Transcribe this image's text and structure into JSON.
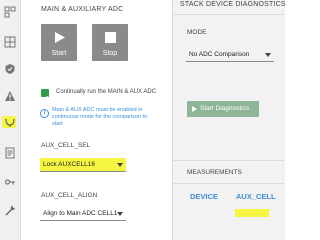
{
  "main": {
    "section_title": "MAIN & AUXILIARY ADC",
    "start_button_label": "Start",
    "stop_button_label": "Stop",
    "continuous_checkbox_label": "Continually run the MAIN & AUX ADC",
    "continuous_checked": true,
    "info_text": "Main & AUX ADC must be enabled in continuous mode for the comparison to start",
    "aux_cell_sel_label": "AUX_CELL_SEL",
    "aux_cell_sel_value": "Lock AUXCELL16",
    "aux_cell_align_label": "AUX_CELL_ALIGN",
    "aux_cell_align_value": "Align to Main ADC CELL1"
  },
  "right": {
    "section_title": "STACK DEVICE DIAGNOSTICS",
    "mode_label": "MODE",
    "mode_value": "No ADC Comparison",
    "start_diagnostics_label": "Start Diagnostics",
    "measurements_label": "MEASUREMENTS",
    "column_device": "DEVICE",
    "column_aux_cell": "AUX_CELL"
  },
  "sidebar": {
    "icons": [
      "dashboard-icon",
      "grid-icon",
      "shield-icon",
      "warning-icon",
      "balance-icon",
      "document-icon",
      "link-icon",
      "wrench-icon"
    ],
    "active_icon": "balance-icon"
  },
  "colors": {
    "highlight": "#f5f542",
    "accent_blue": "#3f8fd6",
    "checkbox_green": "#2e9c4b",
    "diag_button_green": "#8fb597",
    "big_button_gray": "#8a8a8a"
  }
}
